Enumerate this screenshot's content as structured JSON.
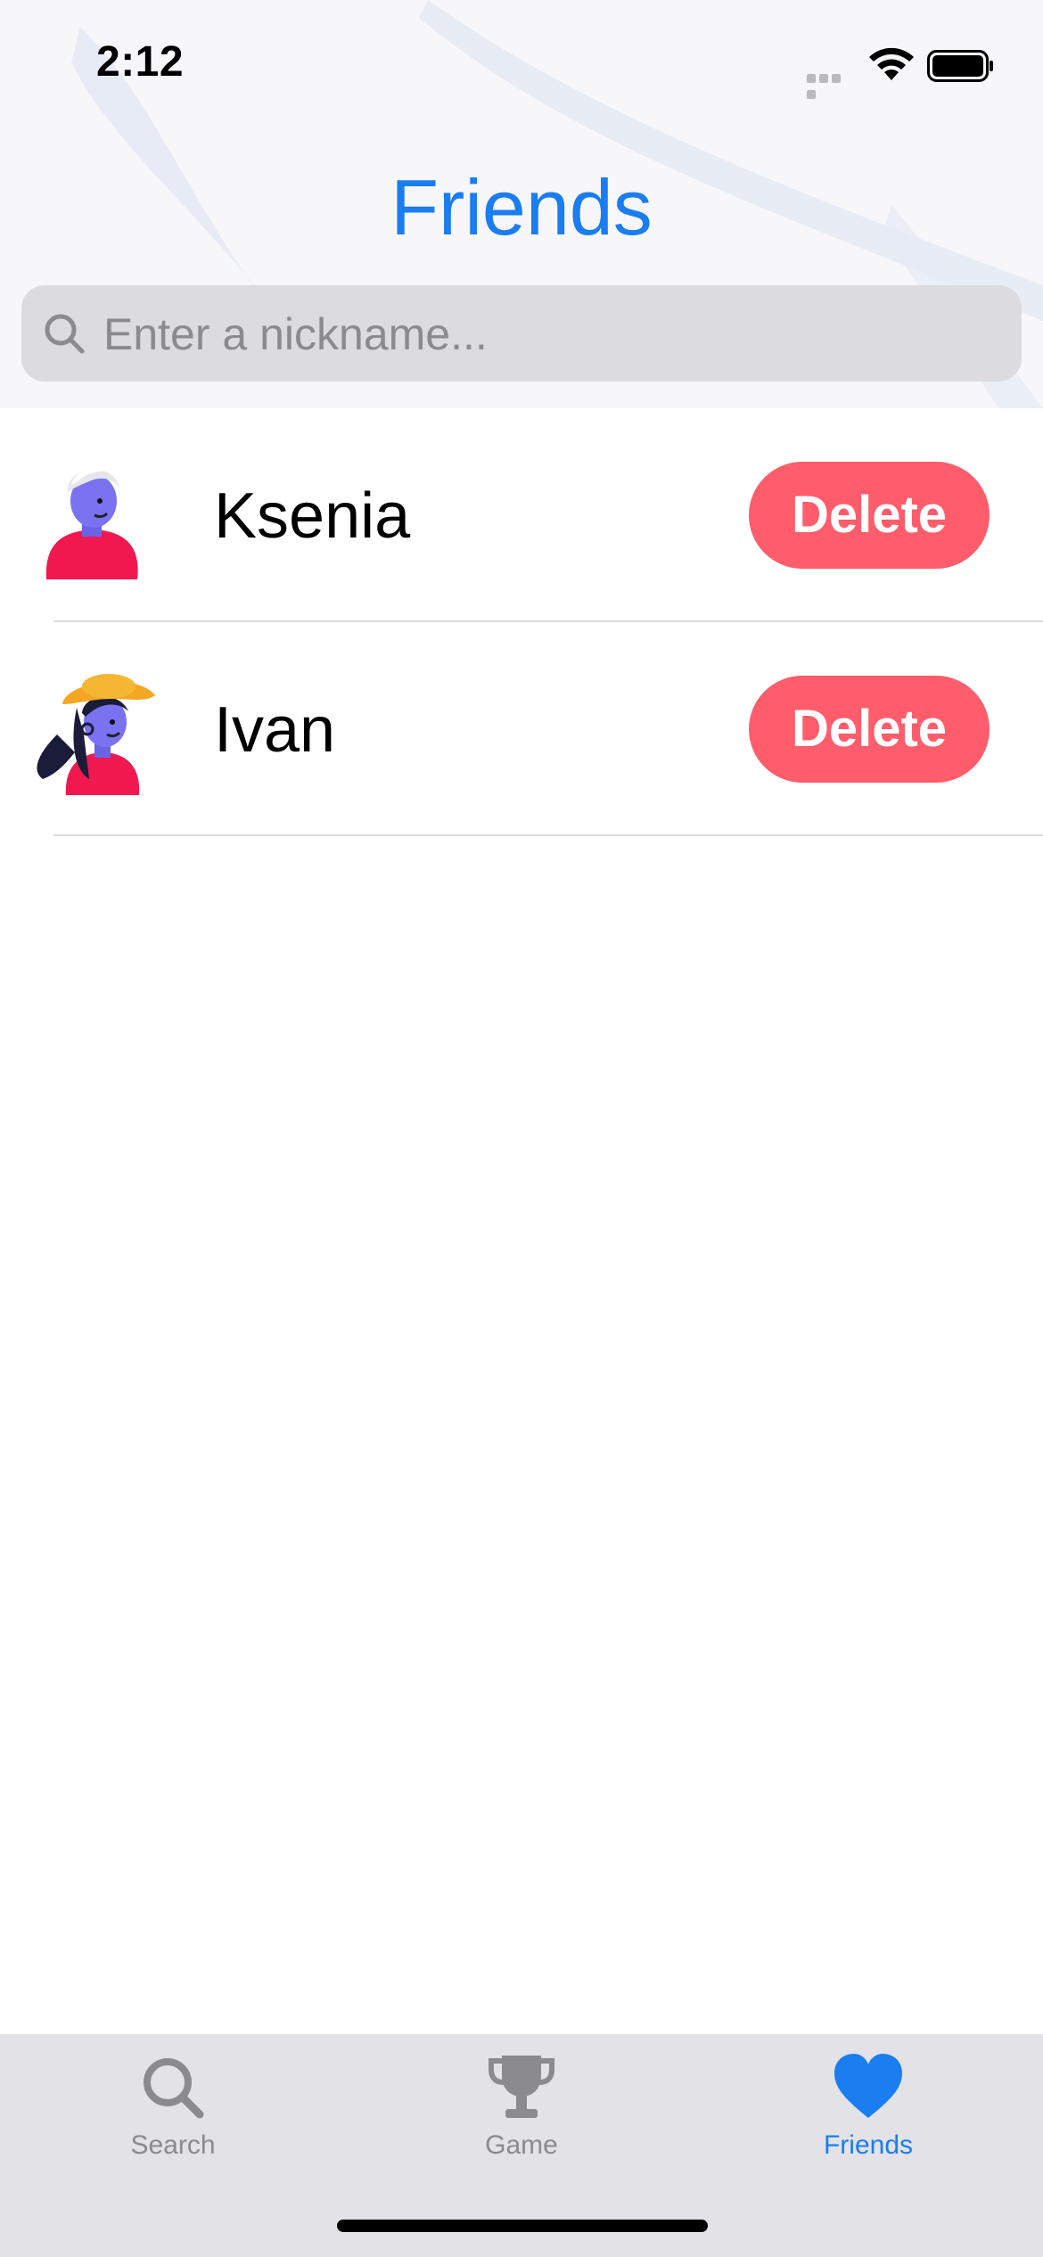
{
  "status_bar": {
    "time": "2:12"
  },
  "header": {
    "title": "Friends"
  },
  "search": {
    "placeholder": "Enter a nickname...",
    "value": ""
  },
  "friends": [
    {
      "name": "Ksenia",
      "avatar": "avatar-white-hair-man",
      "action_label": "Delete"
    },
    {
      "name": "Ivan",
      "avatar": "avatar-woman-yellow-hat",
      "action_label": "Delete"
    }
  ],
  "tab_bar": {
    "tabs": [
      {
        "label": "Search",
        "icon": "search-icon",
        "active": false
      },
      {
        "label": "Game",
        "icon": "trophy-icon",
        "active": false
      },
      {
        "label": "Friends",
        "icon": "heart-icon",
        "active": true
      }
    ]
  },
  "colors": {
    "accent": "#1a7df0",
    "delete": "#ff5c6c",
    "tab_inactive": "#8a8a8f",
    "tab_bar_bg": "#e2e2e7"
  }
}
